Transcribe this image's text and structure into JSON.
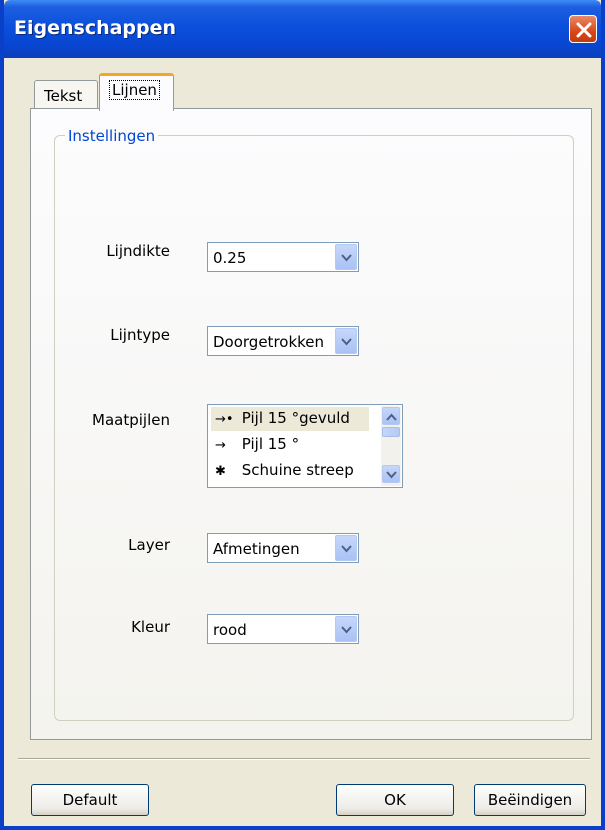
{
  "window": {
    "title": "Eigenschappen"
  },
  "tabs": [
    {
      "label": "Tekst",
      "active": false
    },
    {
      "label": "Lijnen",
      "active": true
    }
  ],
  "group": {
    "title": "Instellingen"
  },
  "fields": {
    "lijndikte": {
      "label": "Lijndikte",
      "value": "0.25"
    },
    "lijntype": {
      "label": "Lijntype",
      "value": "Doorgetrokken"
    },
    "maatpijlen": {
      "label": "Maatpijlen",
      "items": [
        {
          "glyph": "→•",
          "label": "Pijl 15 °gevuld",
          "selected": true
        },
        {
          "glyph": "→",
          "label": "Pijl 15 °",
          "selected": false
        },
        {
          "glyph": "✱",
          "label": "Schuine streep",
          "selected": false
        }
      ]
    },
    "layer": {
      "label": "Layer",
      "value": "Afmetingen"
    },
    "kleur": {
      "label": "Kleur",
      "value": "rood"
    }
  },
  "buttons": {
    "default": "Default",
    "ok": "OK",
    "close": "Beëindigen"
  },
  "icons": {
    "close": "close-icon",
    "dropdown": "chevron-down-icon",
    "scroll_up": "chevron-up-icon",
    "scroll_down": "chevron-down-icon"
  },
  "colors": {
    "titlebar": "#0A50DC",
    "accent_tab": "#F5A623",
    "group_title": "#0046D5",
    "close_button": "#D84818"
  }
}
